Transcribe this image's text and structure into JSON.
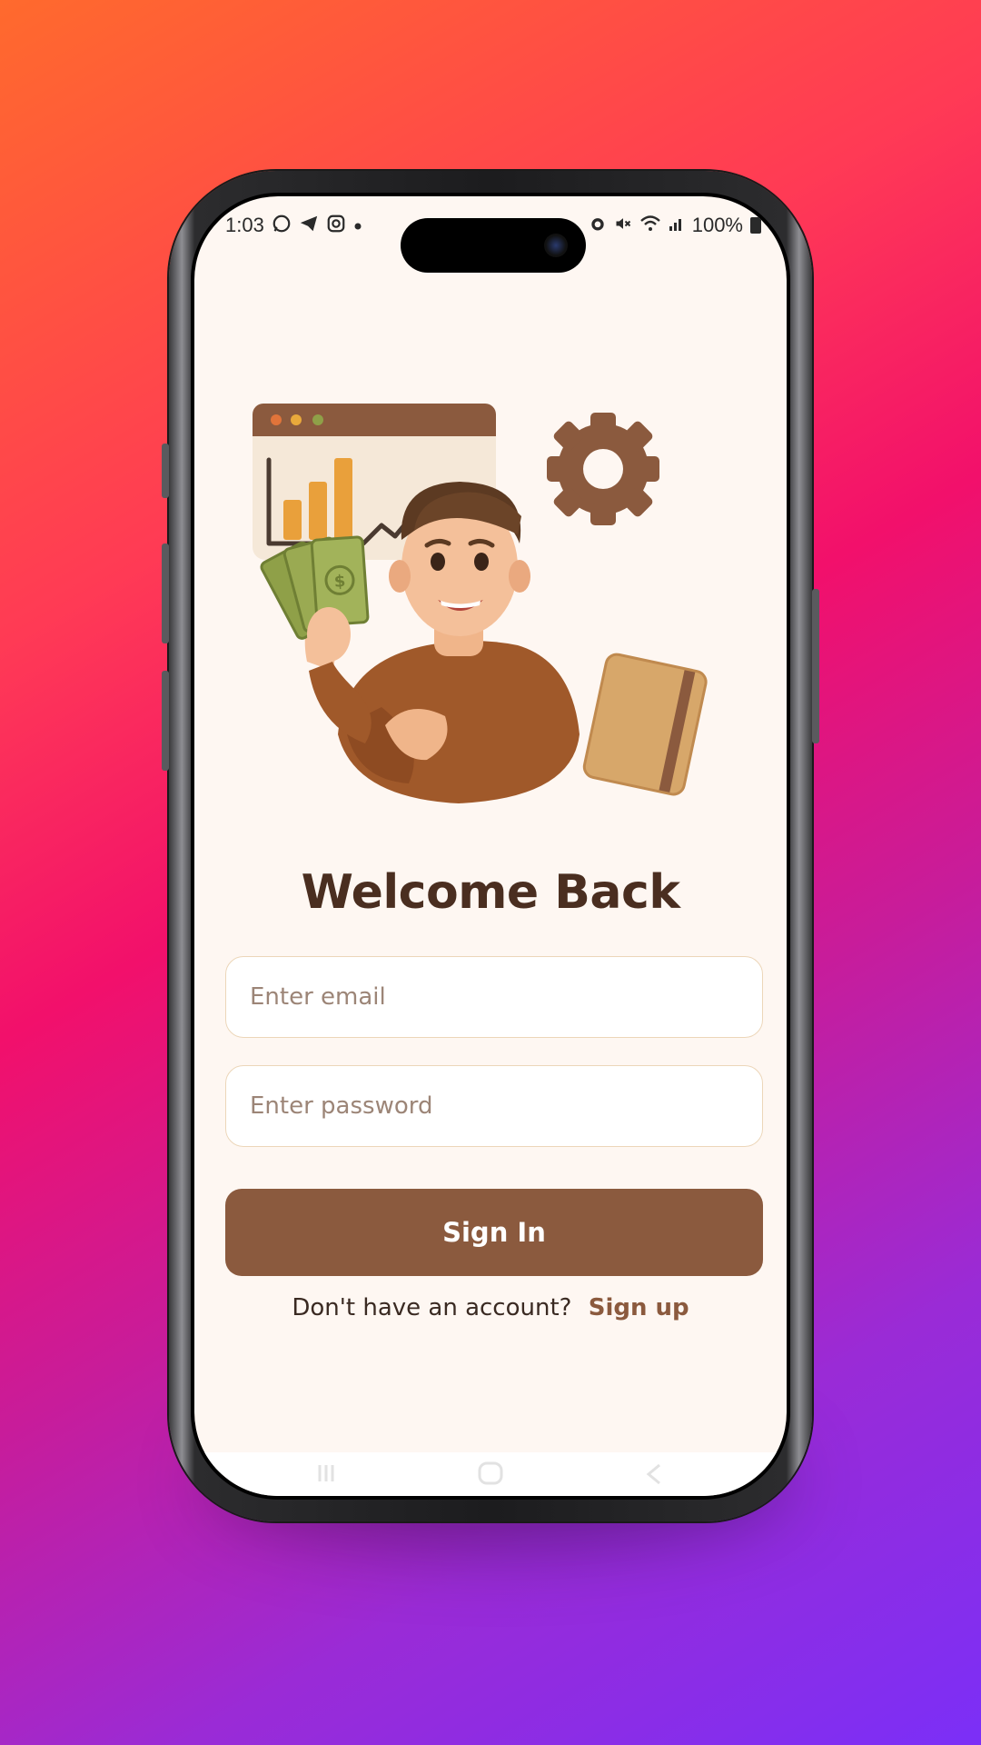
{
  "status_bar": {
    "time": "1:03",
    "left_icons": [
      "whatsapp-icon",
      "telegram-icon",
      "instagram-icon",
      "dot-icon"
    ],
    "right_icons": [
      "alarm-icon",
      "mute-icon",
      "wifi-icon",
      "signal-icon"
    ],
    "battery": "100%"
  },
  "illustration": {
    "subject": "person-with-money-illustration"
  },
  "login": {
    "title": "Welcome Back",
    "email_placeholder": "Enter email",
    "password_placeholder": "Enter password",
    "signin_label": "Sign In",
    "signup_prompt": "Don't have an account?",
    "signup_link": "Sign up"
  },
  "colors": {
    "background": "#fef7f2",
    "primary": "#8b5a3e",
    "title": "#4a2e20",
    "field_border": "#ecd6b9",
    "placeholder": "#9c8577"
  }
}
